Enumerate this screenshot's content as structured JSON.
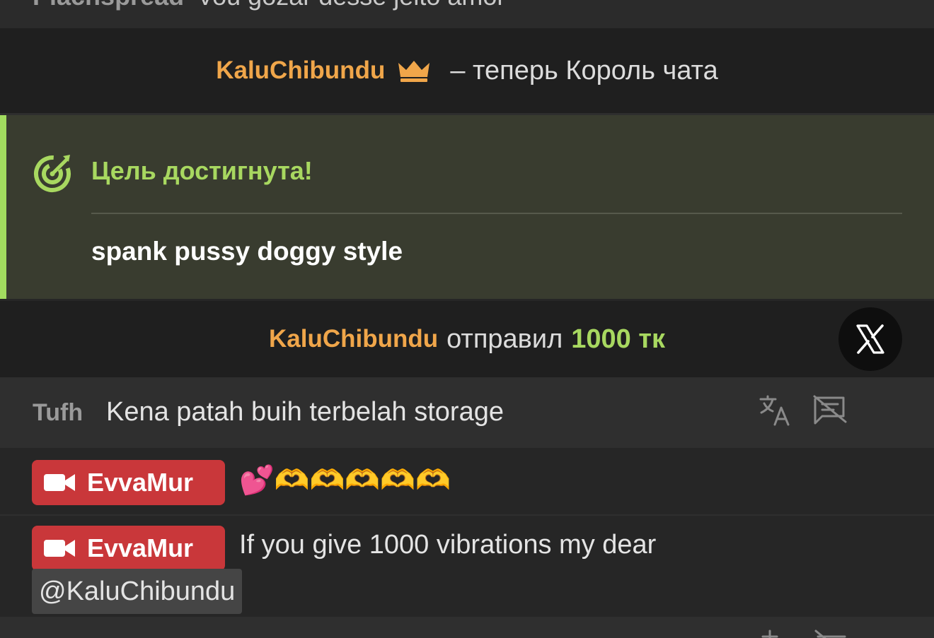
{
  "top_row": {
    "username": "Plachspread",
    "message": "Vou gozar desse jeito amor"
  },
  "king_banner": {
    "username": "KaluChibundu",
    "text": "– теперь Король чата",
    "icon": "crown-icon"
  },
  "goal": {
    "title": "Цель достигнута!",
    "text": "spank pussy doggy style",
    "icon": "target-icon"
  },
  "tip": {
    "username": "KaluChibundu",
    "verb": "отправил",
    "amount": "1000 тк"
  },
  "messages": [
    {
      "username": "Tufh",
      "text": "Kena patah buih terbelah storage"
    },
    {
      "username": "EvvaMur",
      "text": "💕🫶🫶🫶🫶🫶",
      "badge_icon": "video-camera-icon"
    },
    {
      "username": "EvvaMur",
      "text": "If you give 1000 vibrations my dear",
      "mention": "@KaluChibundu",
      "badge_icon": "video-camera-icon"
    }
  ],
  "colors": {
    "accent_orange": "#f0a64a",
    "accent_green": "#a8d860",
    "model_badge": "#c9373a"
  }
}
